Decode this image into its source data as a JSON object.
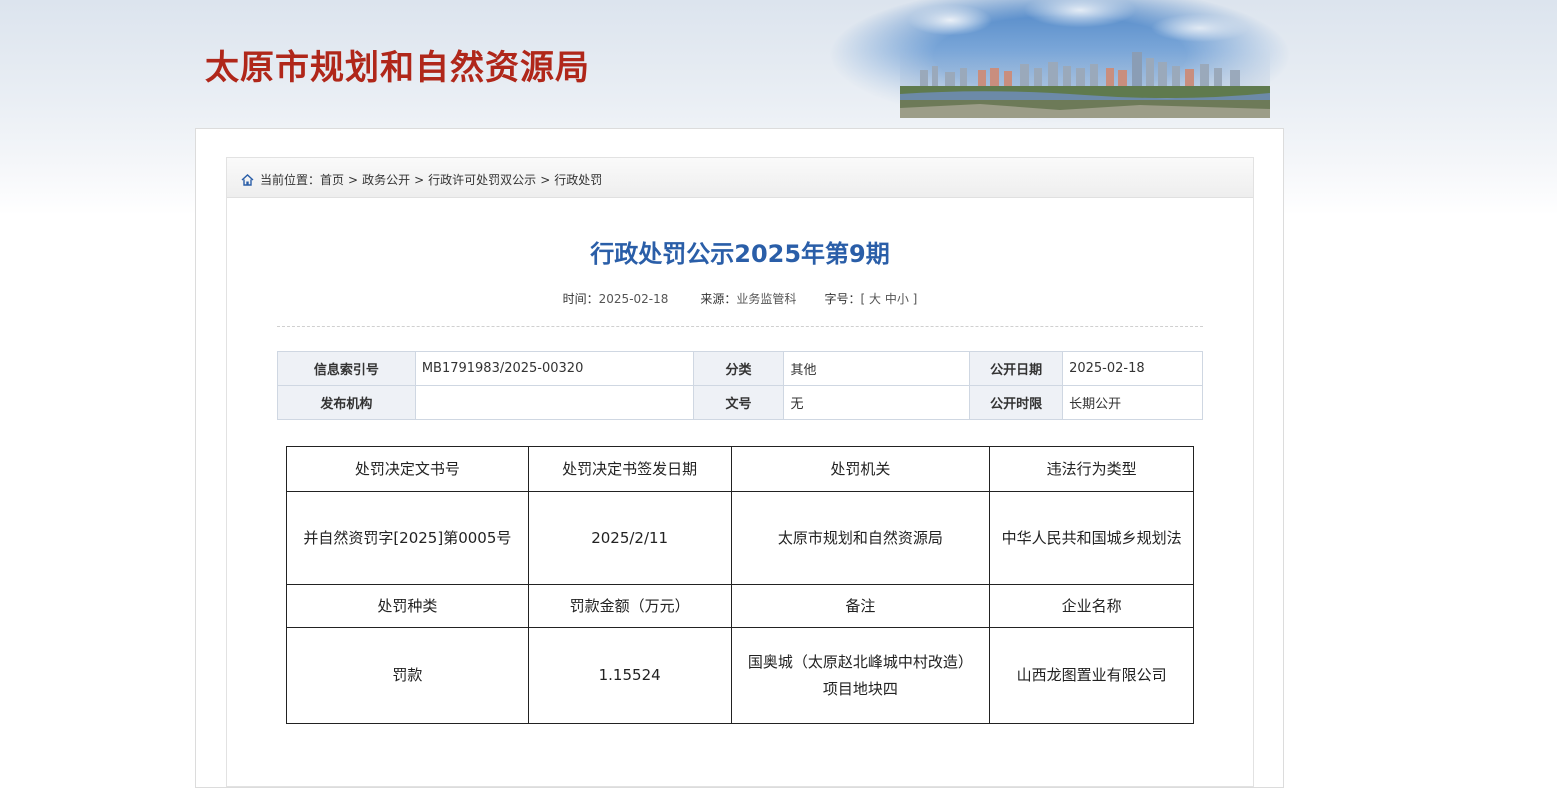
{
  "header": {
    "site_title": "太原市规划和自然资源局"
  },
  "breadcrumb": {
    "prefix": "当前位置：",
    "items": [
      "首页",
      "政务公开",
      "行政许可处罚双公示",
      "行政处罚"
    ],
    "separator": ">"
  },
  "article": {
    "title": "行政处罚公示2025年第9期",
    "time_label": "时间：",
    "time_value": "2025-02-18",
    "source_label": "来源：",
    "source_value": "业务监管科",
    "fontsize_label": "字号：",
    "fontsize_open": "[",
    "fontsize_large": "大",
    "fontsize_medium": "中",
    "fontsize_small": "小",
    "fontsize_close": "]"
  },
  "info_table": {
    "index_label": "信息索引号",
    "index_value": "MB1791983/2025-00320",
    "category_label": "分类",
    "category_value": "其他",
    "open_date_label": "公开日期",
    "open_date_value": "2025-02-18",
    "publisher_label": "发布机构",
    "publisher_value": "",
    "doc_no_label": "文号",
    "doc_no_value": "无",
    "open_period_label": "公开时限",
    "open_period_value": "长期公开"
  },
  "penalty_table": {
    "headers1": [
      "处罚决定文书号",
      "处罚决定书签发日期",
      "处罚机关",
      "违法行为类型"
    ],
    "row1": [
      "并自然资罚字[2025]第0005号",
      "2025/2/11",
      "太原市规划和自然资源局",
      "中华人民共和国城乡规划法"
    ],
    "headers2": [
      "处罚种类",
      "罚款金额（万元）",
      "备注",
      "企业名称"
    ],
    "row2": [
      "罚款",
      "1.15524",
      "国奥城（太原赵北峰城中村改造）项目地块四",
      "山西龙图置业有限公司"
    ]
  },
  "colors": {
    "site_title": "#b0271a",
    "article_title": "#2a5ea8",
    "info_key_bg": "#eef1f6"
  },
  "icons": {
    "breadcrumb": "home-icon"
  }
}
